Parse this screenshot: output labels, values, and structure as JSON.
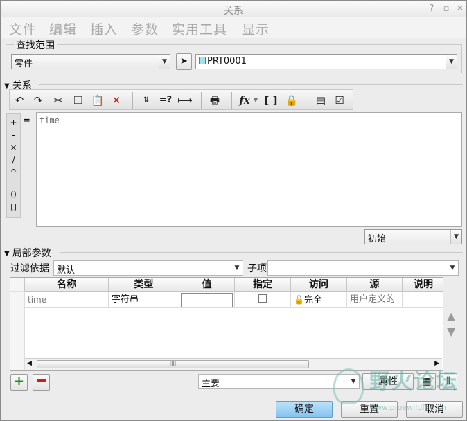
{
  "window": {
    "title": "关系"
  },
  "menu": {
    "items": [
      "文件",
      "编辑",
      "插入",
      "参数",
      "实用工具",
      "显示"
    ]
  },
  "lookin": {
    "legend": "查找范围",
    "scope_value": "零件",
    "model_value": "PRT0001"
  },
  "relations": {
    "section_label": "关系",
    "editor_text": "time",
    "equals_symbol": "=",
    "operators": [
      "+",
      "-",
      "×",
      "/",
      "^",
      "()",
      "[]"
    ],
    "state_value": "初始"
  },
  "local_params": {
    "section_label": "局部参数",
    "filter_label": "过滤依据",
    "filter_value": "默认",
    "subitem_label": "子项",
    "subitem_value": "",
    "columns": [
      "名称",
      "类型",
      "值",
      "指定",
      "访问",
      "源",
      "说明"
    ],
    "rows": [
      {
        "name": "time",
        "type": "字符串",
        "value": "",
        "designated": false,
        "access": "完全",
        "source": "用户定义的",
        "description": ""
      }
    ],
    "scroll_thumb_glyph": "IIII",
    "main_value": "主要",
    "properties_button": "属性"
  },
  "footer": {
    "ok": "确定",
    "reset": "重置",
    "cancel": "取消"
  },
  "watermark": {
    "text": "野火论坛",
    "url": "www.proewildfire.cn"
  },
  "icons": {
    "title_buttons": [
      "help-icon",
      "minimize-icon",
      "close-icon"
    ],
    "toolbar": [
      "undo-icon",
      "redo-icon",
      "cut-icon",
      "copy-icon",
      "paste-icon",
      "delete-icon",
      "sort-params-icon",
      "evaluate-icon",
      "dimension-icon",
      "verify-icon",
      "function-icon",
      "brackets-icon",
      "lock-icon",
      "spreadsheet-icon",
      "check-icon"
    ]
  },
  "colors": {
    "add": "#1f8d1f",
    "remove": "#c42020",
    "primary_button": "#9fd3f7"
  }
}
